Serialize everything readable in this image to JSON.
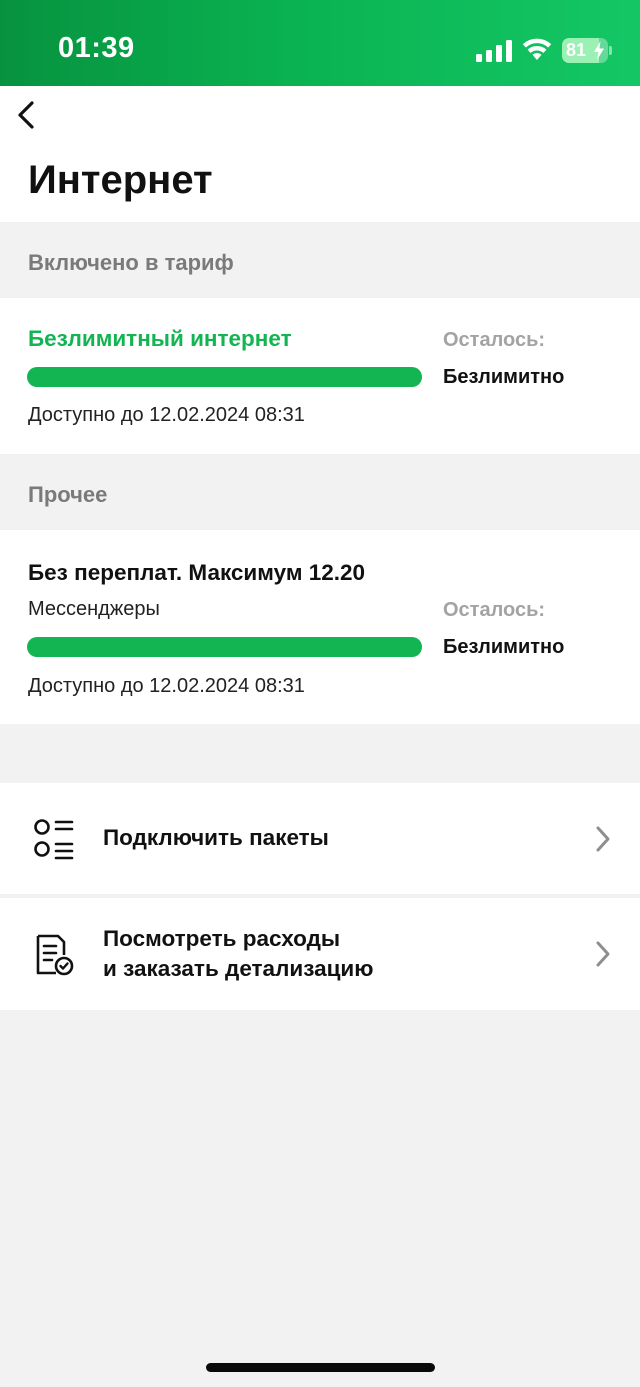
{
  "status_bar": {
    "time": "01:39",
    "battery": "81",
    "battery_level": 0.81
  },
  "header": {
    "title": "Интернет"
  },
  "sections": {
    "included": {
      "label": "Включено в тариф",
      "package": {
        "title": "Безлимитный интернет",
        "remaining_label": "Осталось:",
        "remaining_value": "Безлимитно",
        "usage_fill": 1.0,
        "available_until": "Доступно до 12.02.2024 08:31"
      }
    },
    "other": {
      "label": "Прочее",
      "package": {
        "title": "Без переплат. Максимум 12.20",
        "subtitle": "Мессенджеры",
        "remaining_label": "Осталось:",
        "remaining_value": "Безлимитно",
        "usage_fill": 1.0,
        "available_until": "Доступно до 12.02.2024 08:31"
      }
    }
  },
  "actions": {
    "connect_packages": {
      "label": "Подключить пакеты",
      "icon": "list-options-icon"
    },
    "expenses": {
      "line1": "Посмотреть расходы",
      "line2": "и заказать детализацию",
      "icon": "document-check-icon"
    }
  },
  "colors": {
    "accent_green": "#13b552",
    "status_bar_green": "#0ab251",
    "background": "#f2f2f2"
  }
}
